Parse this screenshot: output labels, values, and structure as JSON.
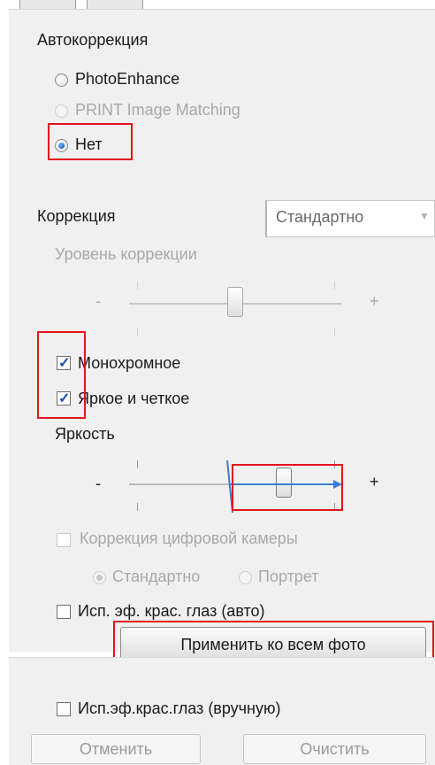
{
  "autocorrection": {
    "heading": "Автокоррекция",
    "options": [
      {
        "label": "PhotoEnhance",
        "selected": false,
        "enabled": true
      },
      {
        "label": "PRINT Image Matching",
        "selected": false,
        "enabled": false
      },
      {
        "label": "Нет",
        "selected": true,
        "enabled": true
      }
    ]
  },
  "correction": {
    "label": "Коррекция",
    "select_value": "Стандартно",
    "level_label": "Уровень коррекции",
    "level_minus": "-",
    "level_plus": "+"
  },
  "checkboxes": {
    "monochrome": {
      "label": "Монохромное",
      "checked": true
    },
    "vivid": {
      "label": "Яркое и четкое",
      "checked": true
    }
  },
  "brightness": {
    "label": "Яркость",
    "minus": "-",
    "plus": "+"
  },
  "digital_camera": {
    "label": "Коррекция цифровой камеры",
    "checked": false,
    "enabled": false,
    "options": [
      {
        "label": "Стандартно",
        "selected": true
      },
      {
        "label": "Портрет",
        "selected": false
      }
    ]
  },
  "red_eye_auto": {
    "label": "Исп. эф. крас. глаз (авто)",
    "checked": false
  },
  "apply_all_button": "Применить ко всем фото",
  "red_eye_manual": {
    "label": "Исп.эф.крас.глаз (вручную)",
    "checked": false
  },
  "cancel_button": "Отменить",
  "clear_button": "Очистить",
  "colors": {
    "highlight": "#e5141c",
    "arrow": "#3a7fd6",
    "accent": "#0b4ea8"
  }
}
